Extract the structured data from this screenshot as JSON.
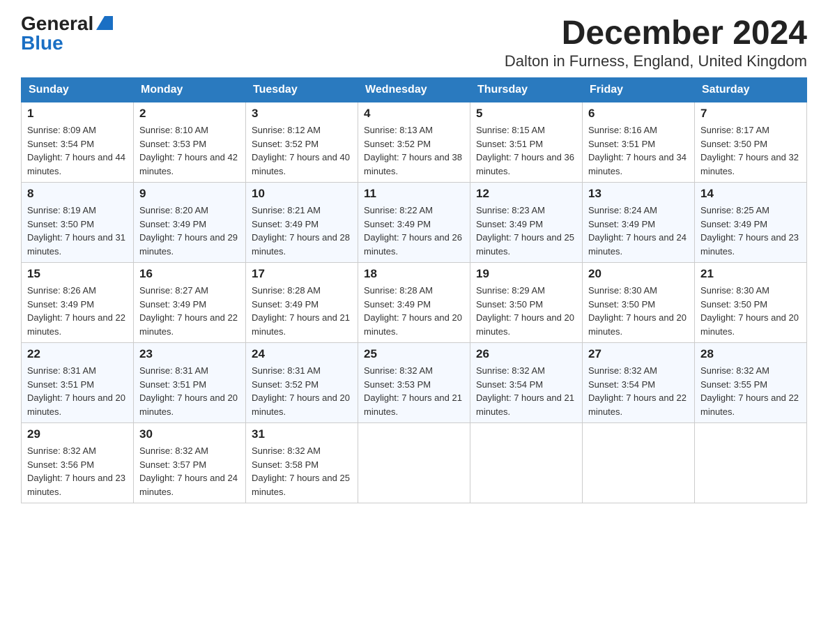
{
  "header": {
    "logo_general": "General",
    "logo_blue": "Blue",
    "month_title": "December 2024",
    "subtitle": "Dalton in Furness, England, United Kingdom"
  },
  "days_of_week": [
    "Sunday",
    "Monday",
    "Tuesday",
    "Wednesday",
    "Thursday",
    "Friday",
    "Saturday"
  ],
  "weeks": [
    [
      {
        "day": "1",
        "sunrise": "8:09 AM",
        "sunset": "3:54 PM",
        "daylight": "7 hours and 44 minutes."
      },
      {
        "day": "2",
        "sunrise": "8:10 AM",
        "sunset": "3:53 PM",
        "daylight": "7 hours and 42 minutes."
      },
      {
        "day": "3",
        "sunrise": "8:12 AM",
        "sunset": "3:52 PM",
        "daylight": "7 hours and 40 minutes."
      },
      {
        "day": "4",
        "sunrise": "8:13 AM",
        "sunset": "3:52 PM",
        "daylight": "7 hours and 38 minutes."
      },
      {
        "day": "5",
        "sunrise": "8:15 AM",
        "sunset": "3:51 PM",
        "daylight": "7 hours and 36 minutes."
      },
      {
        "day": "6",
        "sunrise": "8:16 AM",
        "sunset": "3:51 PM",
        "daylight": "7 hours and 34 minutes."
      },
      {
        "day": "7",
        "sunrise": "8:17 AM",
        "sunset": "3:50 PM",
        "daylight": "7 hours and 32 minutes."
      }
    ],
    [
      {
        "day": "8",
        "sunrise": "8:19 AM",
        "sunset": "3:50 PM",
        "daylight": "7 hours and 31 minutes."
      },
      {
        "day": "9",
        "sunrise": "8:20 AM",
        "sunset": "3:49 PM",
        "daylight": "7 hours and 29 minutes."
      },
      {
        "day": "10",
        "sunrise": "8:21 AM",
        "sunset": "3:49 PM",
        "daylight": "7 hours and 28 minutes."
      },
      {
        "day": "11",
        "sunrise": "8:22 AM",
        "sunset": "3:49 PM",
        "daylight": "7 hours and 26 minutes."
      },
      {
        "day": "12",
        "sunrise": "8:23 AM",
        "sunset": "3:49 PM",
        "daylight": "7 hours and 25 minutes."
      },
      {
        "day": "13",
        "sunrise": "8:24 AM",
        "sunset": "3:49 PM",
        "daylight": "7 hours and 24 minutes."
      },
      {
        "day": "14",
        "sunrise": "8:25 AM",
        "sunset": "3:49 PM",
        "daylight": "7 hours and 23 minutes."
      }
    ],
    [
      {
        "day": "15",
        "sunrise": "8:26 AM",
        "sunset": "3:49 PM",
        "daylight": "7 hours and 22 minutes."
      },
      {
        "day": "16",
        "sunrise": "8:27 AM",
        "sunset": "3:49 PM",
        "daylight": "7 hours and 22 minutes."
      },
      {
        "day": "17",
        "sunrise": "8:28 AM",
        "sunset": "3:49 PM",
        "daylight": "7 hours and 21 minutes."
      },
      {
        "day": "18",
        "sunrise": "8:28 AM",
        "sunset": "3:49 PM",
        "daylight": "7 hours and 20 minutes."
      },
      {
        "day": "19",
        "sunrise": "8:29 AM",
        "sunset": "3:50 PM",
        "daylight": "7 hours and 20 minutes."
      },
      {
        "day": "20",
        "sunrise": "8:30 AM",
        "sunset": "3:50 PM",
        "daylight": "7 hours and 20 minutes."
      },
      {
        "day": "21",
        "sunrise": "8:30 AM",
        "sunset": "3:50 PM",
        "daylight": "7 hours and 20 minutes."
      }
    ],
    [
      {
        "day": "22",
        "sunrise": "8:31 AM",
        "sunset": "3:51 PM",
        "daylight": "7 hours and 20 minutes."
      },
      {
        "day": "23",
        "sunrise": "8:31 AM",
        "sunset": "3:51 PM",
        "daylight": "7 hours and 20 minutes."
      },
      {
        "day": "24",
        "sunrise": "8:31 AM",
        "sunset": "3:52 PM",
        "daylight": "7 hours and 20 minutes."
      },
      {
        "day": "25",
        "sunrise": "8:32 AM",
        "sunset": "3:53 PM",
        "daylight": "7 hours and 21 minutes."
      },
      {
        "day": "26",
        "sunrise": "8:32 AM",
        "sunset": "3:54 PM",
        "daylight": "7 hours and 21 minutes."
      },
      {
        "day": "27",
        "sunrise": "8:32 AM",
        "sunset": "3:54 PM",
        "daylight": "7 hours and 22 minutes."
      },
      {
        "day": "28",
        "sunrise": "8:32 AM",
        "sunset": "3:55 PM",
        "daylight": "7 hours and 22 minutes."
      }
    ],
    [
      {
        "day": "29",
        "sunrise": "8:32 AM",
        "sunset": "3:56 PM",
        "daylight": "7 hours and 23 minutes."
      },
      {
        "day": "30",
        "sunrise": "8:32 AM",
        "sunset": "3:57 PM",
        "daylight": "7 hours and 24 minutes."
      },
      {
        "day": "31",
        "sunrise": "8:32 AM",
        "sunset": "3:58 PM",
        "daylight": "7 hours and 25 minutes."
      },
      null,
      null,
      null,
      null
    ]
  ]
}
